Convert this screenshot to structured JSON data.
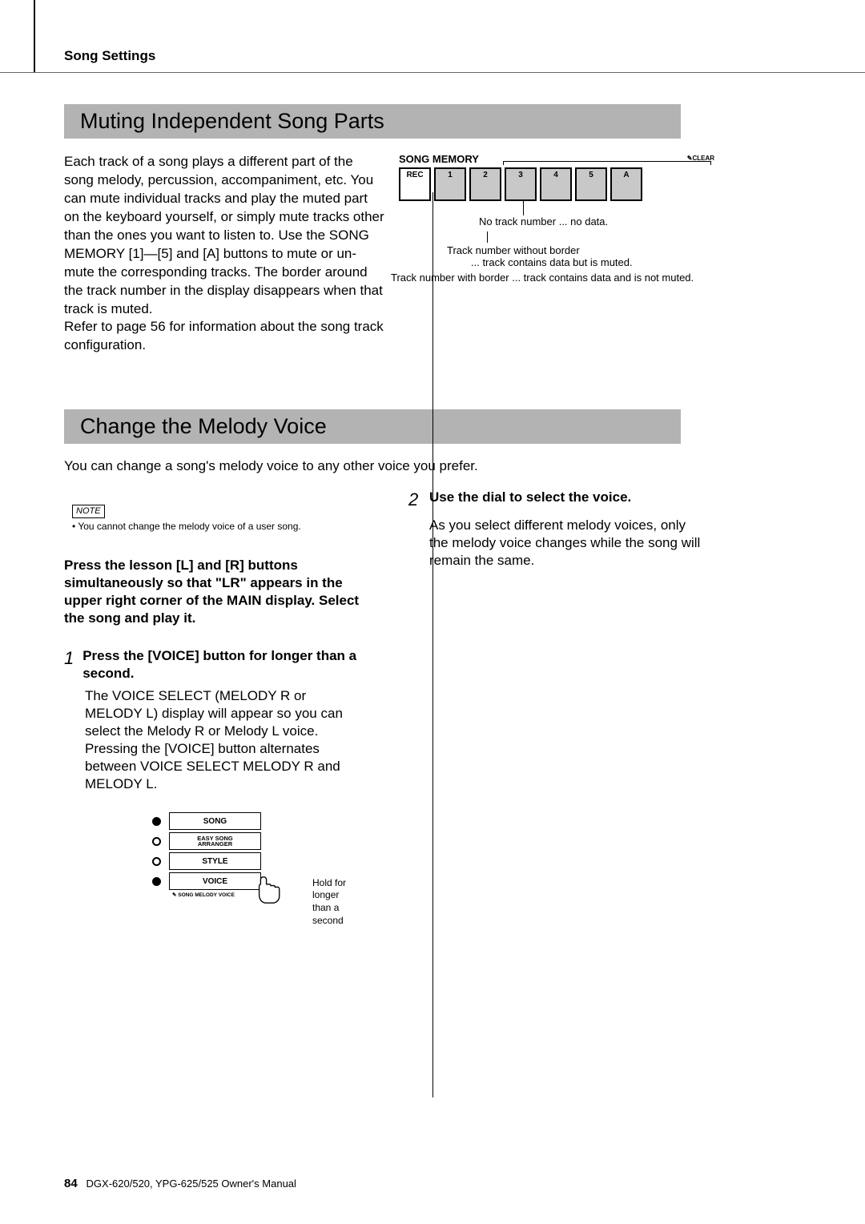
{
  "header": {
    "section": "Song Settings"
  },
  "section1": {
    "title": "Muting Independent Song Parts",
    "body": "Each track of a song plays a different part of the song melody, percussion, accompaniment, etc. You can mute individual tracks and play the muted part on the keyboard yourself, or simply mute tracks other than the ones you want to listen to. Use the SONG MEMORY [1]—[5] and [A] buttons to mute or un-mute the corresponding tracks. The border around the track number in the display disappears when that track is muted.",
    "body2": "Refer to page 56 for information about the song track conﬁguration."
  },
  "memory": {
    "label": "SONG MEMORY",
    "clear": "CLEAR",
    "buttons": [
      "REC",
      "1",
      "2",
      "3",
      "4",
      "5",
      "A"
    ],
    "cap1": "No track number ... no data.",
    "cap2": "Track number without border",
    "cap2b": "... track contains data but is muted.",
    "cap3": "Track number with border ... track contains data and is not muted."
  },
  "section2": {
    "title": "Change the Melody Voice",
    "intro": "You can change a song's melody voice to any other voice you prefer.",
    "note_label": "NOTE",
    "note_text": "• You cannot change the melody voice of a user song.",
    "bold_para": "Press the lesson [L] and [R] buttons simultaneously so that \"LR\" appears in the upper right corner of the MAIN display. Select the song and play it.",
    "step1_num": "1",
    "step1_title": "Press the [VOICE] button for longer than a second.",
    "step1_body": "The VOICE SELECT (MELODY R or MELODY L) display will appear so you can select the Melody R or Melody L voice. Pressing the [VOICE] button alternates between VOICE SELECT MELODY R and MELODY L.",
    "step2_num": "2",
    "step2_title": "Use the dial to select the voice.",
    "step2_body": "As you select different melody voices, only the melody voice changes while the song will remain the same."
  },
  "buttons_panel": {
    "song": "SONG",
    "easy1": "EASY SONG",
    "easy2": "ARRANGER",
    "style": "STYLE",
    "voice": "VOICE",
    "below": "SONG MELODY VOICE",
    "hold": "Hold for longer than a second"
  },
  "footer": {
    "page": "84",
    "text": "DGX-620/520, YPG-625/525  Owner's Manual"
  }
}
